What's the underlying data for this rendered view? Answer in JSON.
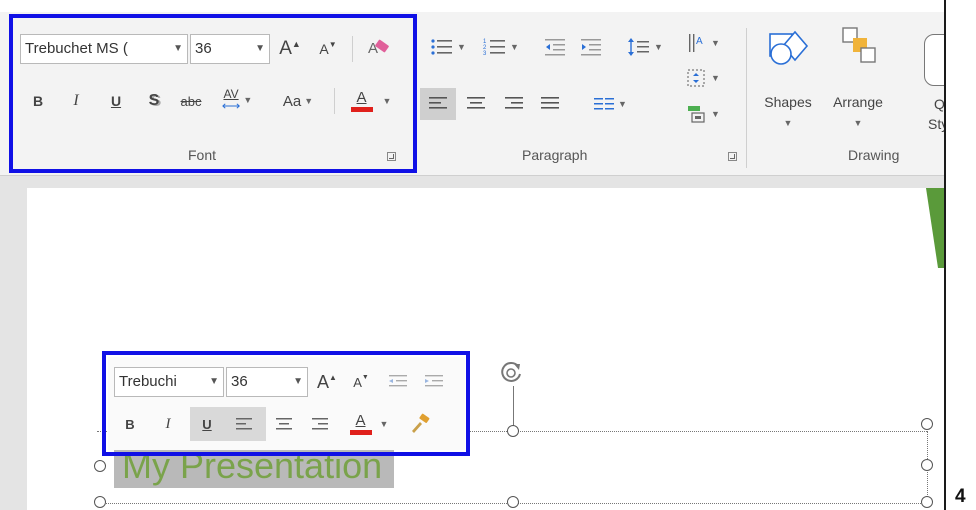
{
  "ribbon": {
    "font_name": "Trebuchet MS (",
    "font_size": "36",
    "font_group_label": "Font",
    "paragraph_group_label": "Paragraph",
    "drawing_group_label": "Drawing",
    "shapes_label": "Shapes",
    "arrange_label": "Arrange",
    "quick_styles_label_1": "Q",
    "quick_styles_label_2": "Sty",
    "bold": "B",
    "italic": "I",
    "underline": "U",
    "shadow": "S",
    "strike": "abc",
    "char_spacing": "AV",
    "change_case": "Aa",
    "font_color": "A",
    "grow_font": "A",
    "shrink_font": "A"
  },
  "mini_toolbar": {
    "font_name": "Trebuchi",
    "font_size": "36",
    "bold": "B",
    "italic": "I",
    "underline": "U",
    "font_color": "A",
    "grow_font": "A",
    "shrink_font": "A"
  },
  "slide": {
    "title_text": "My Presentation"
  },
  "page_number": "4",
  "colors": {
    "highlight_box": "#1010e6",
    "font_color_bar": "#e0201b",
    "title_text": "#7aa34b",
    "slide_accent": "#5a9a3a"
  }
}
